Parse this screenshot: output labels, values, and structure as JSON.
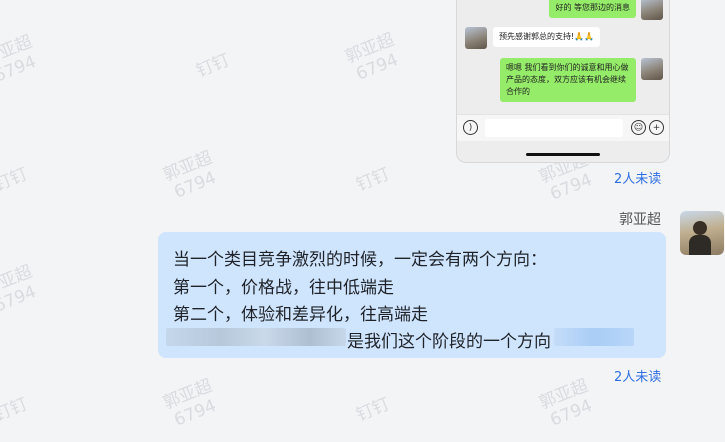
{
  "watermark": {
    "name": "郭亚超",
    "id": "6794",
    "app": "钉钉"
  },
  "phone": {
    "msg1": "好的 等您那边的消息",
    "msg2": "预先感谢郭总的支持!🙏🙏",
    "msg3": "嗯嗯 我们看到你们的诚意和用心做产品的态度，双方应该有机会继续合作的",
    "left_icon": "voice-icon",
    "right_icons": [
      "emoji-icon",
      "plus-icon"
    ]
  },
  "unread_top": "2人未读",
  "sender_name": "郭亚超",
  "message": {
    "line1": "当一个类目竞争激烈的时候，一定会有两个方向：",
    "line2": "第一个，价格战，往中低端走",
    "line3": "第二个，体验和差异化，往高端走",
    "line4": "是我们这个阶段的一个方向"
  },
  "unread_bottom": "2人未读",
  "colors": {
    "bubble": "#cfe4fd",
    "link": "#2f6fe4",
    "wechat_green": "#95ec69"
  }
}
